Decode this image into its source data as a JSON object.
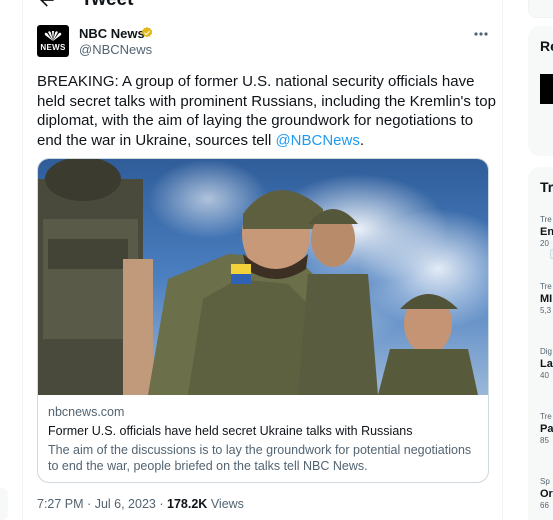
{
  "header": {
    "title": "Tweet",
    "back_icon": "arrow-left-icon"
  },
  "author": {
    "name": "NBC News",
    "handle": "@NBCNews",
    "avatar_text": "NEWS",
    "verified_color": "#e2b719"
  },
  "tweet": {
    "text": "BREAKING: A group of former U.S. national security officials have held secret talks with prominent Russians, including the Kremlin's top diplomat, with the aim of laying the groundwork for negotiations to end the war in Ukraine, sources tell ",
    "mention": "@NBCNews",
    "end": "."
  },
  "card": {
    "domain": "nbcnews.com",
    "title": "Former U.S. officials have held secret Ukraine talks with Russians",
    "description": "The aim of the discussions is to lay the groundwork for potential negotiations to end the war, people briefed on the talks tell NBC News."
  },
  "meta": {
    "time": "7:27 PM",
    "separator": "·",
    "date": "Jul 6, 2023",
    "views_count": "178.2K",
    "views_label": "Views"
  },
  "sidebar": {
    "box1_title": "Re",
    "box2_title": "Tr",
    "trends": [
      {
        "cat": "Tre",
        "name": "En",
        "count": "20"
      },
      {
        "cat": "Tre",
        "name": "MI",
        "count": "5,3"
      },
      {
        "cat": "Dig",
        "name": "La",
        "count": "40"
      },
      {
        "cat": "Tre",
        "name": "Pa",
        "count": "85"
      },
      {
        "cat": "Sp",
        "name": "Or",
        "count": "66"
      }
    ]
  },
  "colors": {
    "accent": "#1d9bf0",
    "secondary_text": "#536471",
    "border": "#cfd9de"
  }
}
